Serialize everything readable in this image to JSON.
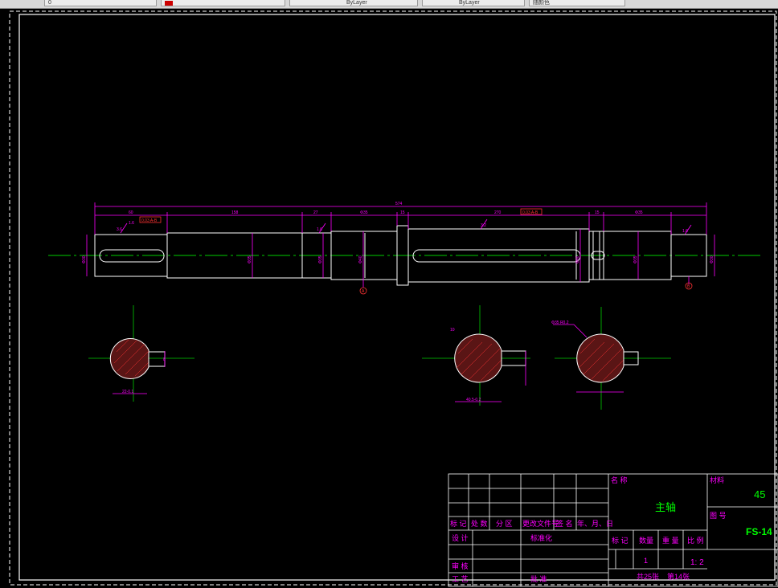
{
  "toolbar": {
    "layer_value": "0",
    "linetype_value": "ByLayer",
    "lineweight_value": "ByLayer",
    "plotstyle_value": "随颜色"
  },
  "colors": {
    "background": "#000000",
    "outline": "#ffffff",
    "dimension": "#ff00ff",
    "centerline": "#00cc00",
    "hatch": "#ff3333",
    "title_text": "#00ff00",
    "label_text": "#ff00ff"
  },
  "dimensions": {
    "overall_length": "574",
    "seg1": "60",
    "seg2": "158",
    "seg3": "27",
    "seg4": "Φ35",
    "seg5": "15",
    "seg6": "270",
    "seg7": "15",
    "seg8": "Φ35",
    "gdt_left": "0.03 A-B",
    "gdt_right": "0.03 A-B",
    "roughness_1": "3.6",
    "roughness_2": "1.6",
    "roughness_3": "3.2",
    "roughness_4": "1.6",
    "roughness_5": "1.6",
    "dia_1": "Φ30",
    "dia_2": "Φ35",
    "dia_3": "Φ35",
    "dia_4": "Φ40",
    "dia_5": "Φ40",
    "dia_6": "Φ35",
    "dia_7": "Φ30",
    "datum_a": "A",
    "datum_b": "B",
    "section1_width": "22-0.1",
    "section1_key": "8",
    "section2_width": "40.5-0.2",
    "section2_key": "10",
    "section3_label": "Φ35 R0.2"
  },
  "title_block": {
    "name_label": "名 称",
    "part_name": "主轴",
    "material_label": "材料",
    "material": "45",
    "drawing_no_label": "图 号",
    "drawing_no": "FS-14",
    "header_mark": "标 记",
    "header_count": "处 数",
    "header_zone": "分 区",
    "header_doc": "更改文件号",
    "header_sign": "签 名",
    "header_date": "年、月、日",
    "design_label": "设 计",
    "standard_label": "标准化",
    "review_label": "审 核",
    "process_label": "工 艺",
    "approve_label": "批 准",
    "col_mark": "标 记",
    "col_qty": "数量",
    "col_weight": "重 量",
    "col_scale": "比 例",
    "qty_value": "1",
    "scale_value": "1: 2",
    "sheets_total": "共25张",
    "sheet_no": "第14张"
  }
}
